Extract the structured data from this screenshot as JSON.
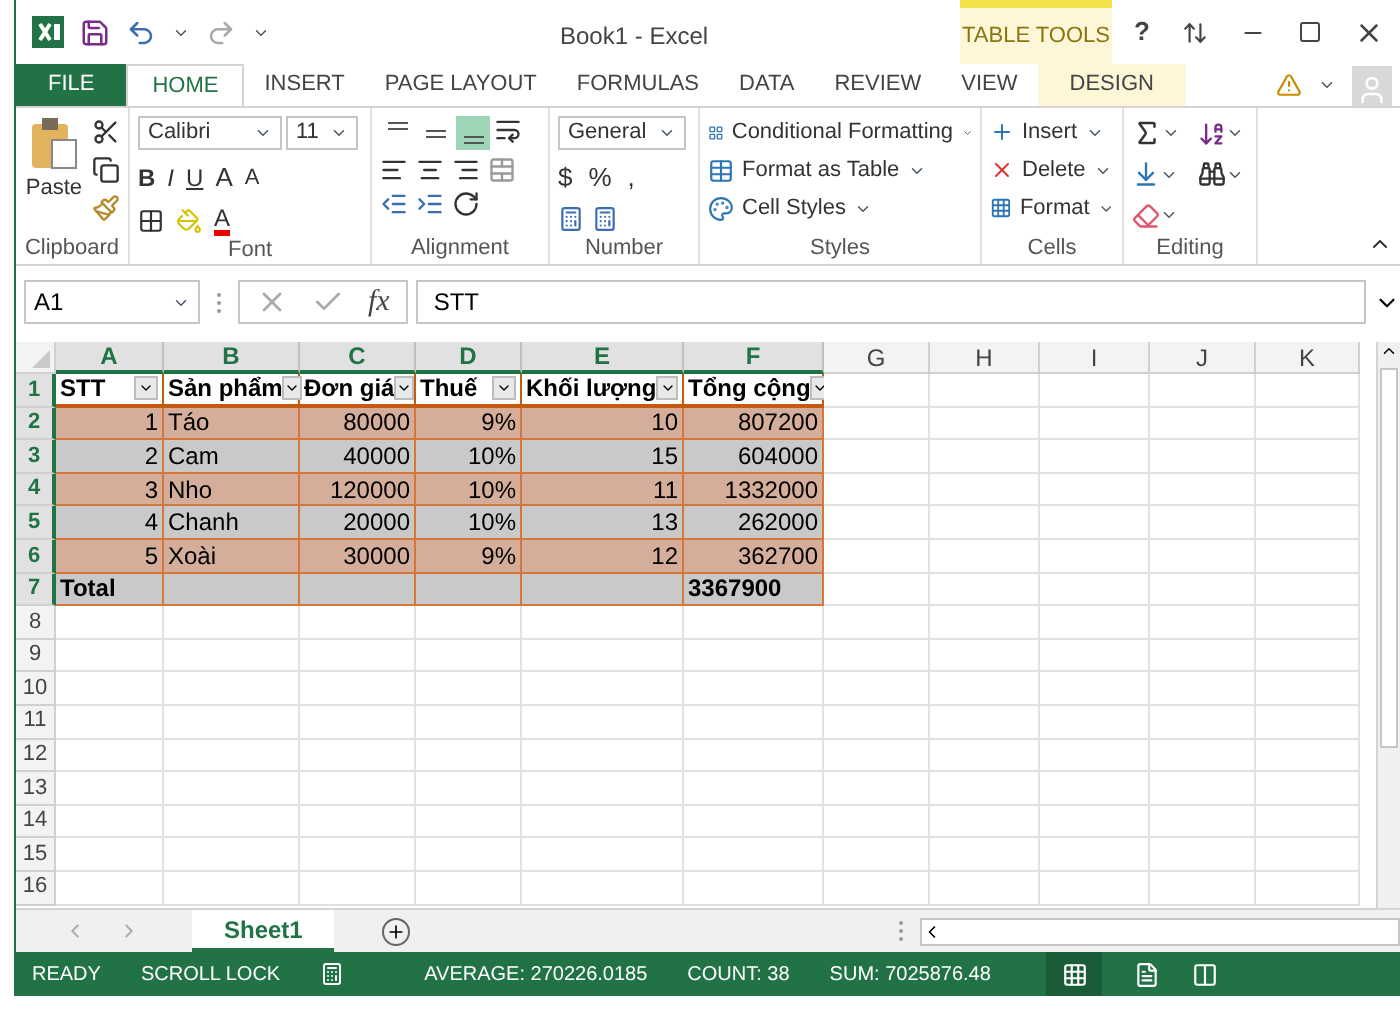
{
  "title_bar": {
    "title": "Book1 - Excel",
    "context_group": "TABLE TOOLS",
    "help": "?"
  },
  "ribbon_tabs": [
    {
      "label": "FILE",
      "kind": "file",
      "selected": false
    },
    {
      "label": "HOME",
      "kind": "normal",
      "selected": true
    },
    {
      "label": "INSERT",
      "kind": "normal",
      "selected": false
    },
    {
      "label": "PAGE LAYOUT",
      "kind": "normal",
      "selected": false
    },
    {
      "label": "FORMULAS",
      "kind": "normal",
      "selected": false
    },
    {
      "label": "DATA",
      "kind": "normal",
      "selected": false
    },
    {
      "label": "REVIEW",
      "kind": "normal",
      "selected": false
    },
    {
      "label": "VIEW",
      "kind": "normal",
      "selected": false
    },
    {
      "label": "DESIGN",
      "kind": "context",
      "selected": false
    }
  ],
  "ribbon": {
    "clipboard": {
      "paste": "Paste",
      "label": "Clipboard"
    },
    "font": {
      "name": "Calibri",
      "size": "11",
      "style_buttons": [
        "B",
        "I",
        "U"
      ],
      "size_buttons": [
        "A",
        "A"
      ],
      "font_color": "A",
      "label": "Font"
    },
    "alignment": {
      "vertical_buttons": [
        {
          "kind": "top",
          "selected": false
        },
        {
          "kind": "middle",
          "selected": false
        },
        {
          "kind": "bottom",
          "selected": true
        }
      ],
      "label": "Alignment"
    },
    "number": {
      "format": "General",
      "symbols": [
        "$",
        "%",
        ","
      ],
      "label": "Number"
    },
    "styles": {
      "items": [
        "Conditional Formatting",
        "Format as Table",
        "Cell Styles"
      ],
      "label": "Styles"
    },
    "cells": {
      "items": [
        "Insert",
        "Delete",
        "Format"
      ],
      "label": "Cells"
    },
    "editing": {
      "label": "Editing"
    }
  },
  "formula_bar": {
    "name_box": "A1",
    "function_label": "fx",
    "content": "STT"
  },
  "grid": {
    "columns": [
      {
        "letter": "A",
        "selected": true
      },
      {
        "letter": "B",
        "selected": true
      },
      {
        "letter": "C",
        "selected": true
      },
      {
        "letter": "D",
        "selected": true
      },
      {
        "letter": "E",
        "selected": true
      },
      {
        "letter": "F",
        "selected": true
      },
      {
        "letter": "G",
        "selected": false
      },
      {
        "letter": "H",
        "selected": false
      },
      {
        "letter": "I",
        "selected": false
      },
      {
        "letter": "J",
        "selected": false
      },
      {
        "letter": "K",
        "selected": false
      }
    ],
    "rows": [
      {
        "number": "1",
        "kind": "header",
        "color": "#ffffff",
        "selected": true,
        "cells": [
          "STT",
          "Sản phẩm",
          "Đơn giá",
          "Thuế",
          "Khối lượng",
          "Tổng cộng"
        ]
      },
      {
        "number": "2",
        "kind": "data",
        "color": "#d5ae9b",
        "selected": true,
        "cells": [
          "1",
          "Táo",
          "80000",
          "9%",
          "10",
          "807200"
        ]
      },
      {
        "number": "3",
        "kind": "data",
        "color": "#c9c9c9",
        "selected": true,
        "cells": [
          "2",
          "Cam",
          "40000",
          "10%",
          "15",
          "604000"
        ]
      },
      {
        "number": "4",
        "kind": "data",
        "color": "#d5ae9b",
        "selected": true,
        "cells": [
          "3",
          "Nho",
          "120000",
          "10%",
          "11",
          "1332000"
        ]
      },
      {
        "number": "5",
        "kind": "data",
        "color": "#c9c9c9",
        "selected": true,
        "cells": [
          "4",
          "Chanh",
          "20000",
          "10%",
          "13",
          "262000"
        ]
      },
      {
        "number": "6",
        "kind": "data",
        "color": "#d5ae9b",
        "selected": true,
        "cells": [
          "5",
          "Xoài",
          "30000",
          "9%",
          "12",
          "362700"
        ]
      },
      {
        "number": "7",
        "kind": "total",
        "color": "#c9c9c9",
        "selected": true,
        "cells": [
          "Total",
          "",
          "",
          "",
          "",
          "3367900"
        ]
      },
      {
        "number": "8",
        "kind": "blank",
        "selected": false,
        "cells": []
      },
      {
        "number": "9",
        "kind": "blank",
        "selected": false,
        "cells": []
      },
      {
        "number": "10",
        "kind": "blank",
        "selected": false,
        "cells": []
      },
      {
        "number": "11",
        "kind": "blank",
        "selected": false,
        "cells": []
      },
      {
        "number": "12",
        "kind": "blank",
        "selected": false,
        "cells": []
      },
      {
        "number": "13",
        "kind": "blank",
        "selected": false,
        "cells": []
      },
      {
        "number": "14",
        "kind": "blank",
        "selected": false,
        "cells": []
      },
      {
        "number": "15",
        "kind": "blank",
        "selected": false,
        "cells": []
      },
      {
        "number": "16",
        "kind": "blank",
        "selected": false,
        "cells": []
      }
    ]
  },
  "sheet_tabs": [
    {
      "label": "Sheet1",
      "selected": true
    }
  ],
  "status_bar": {
    "items": [
      "READY",
      "SCROLL LOCK"
    ],
    "stats": [
      "AVERAGE: 270226.0185",
      "COUNT: 38",
      "SUM: 7025876.48"
    ]
  }
}
